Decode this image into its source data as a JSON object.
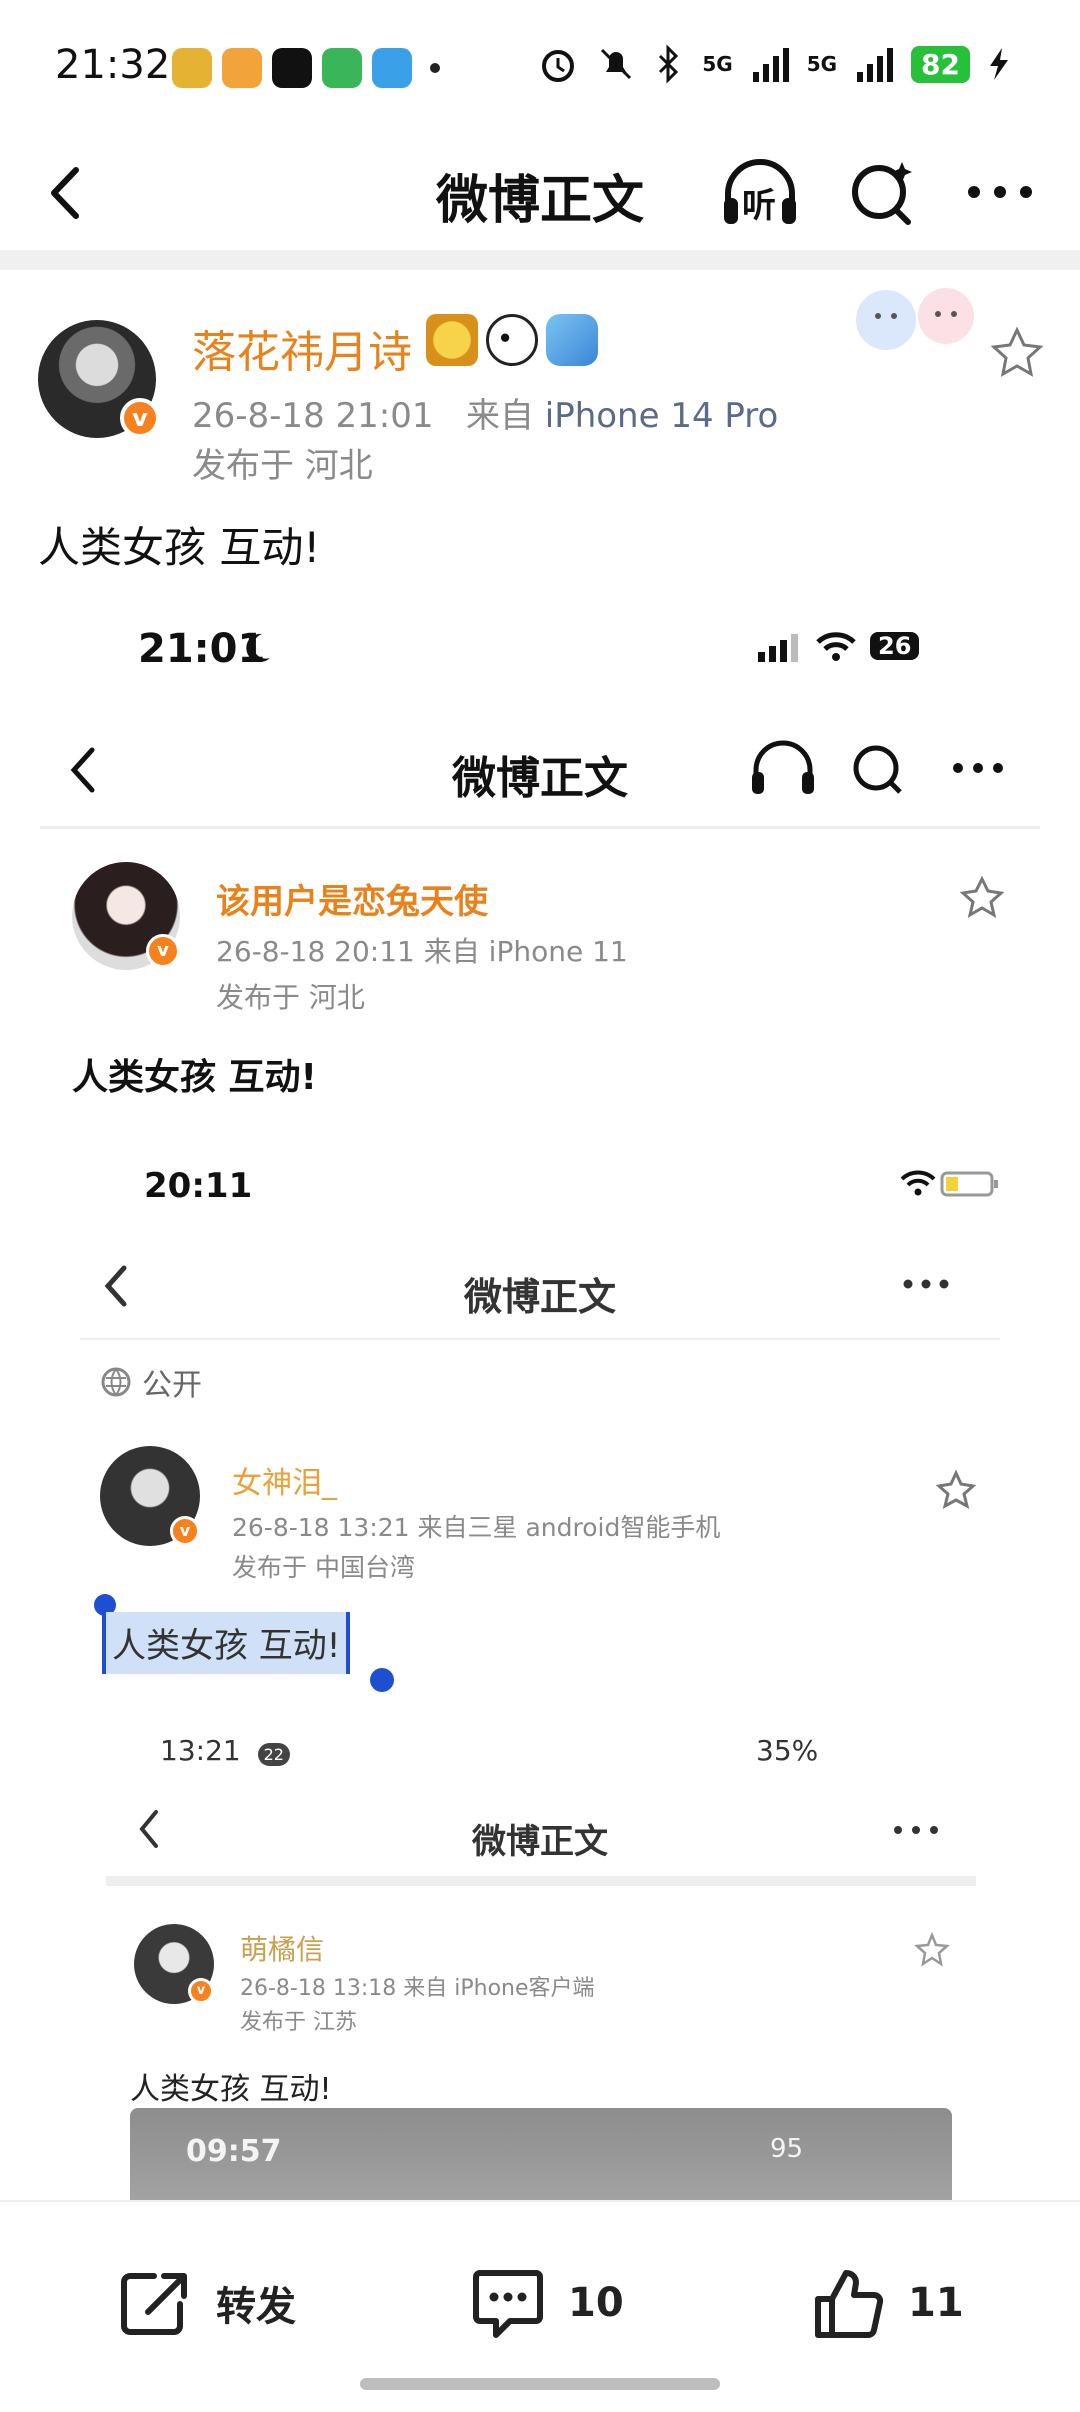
{
  "status_bar": {
    "time": "21:32",
    "network_left": "5G",
    "network_right": "5G",
    "battery": "82"
  },
  "nav": {
    "title": "微博正文",
    "listen_label": "听"
  },
  "post": {
    "author": "落花祎月诗",
    "verified_badge": "v",
    "time": "26-8-18 21:01",
    "source_prefix": "来自",
    "device": "iPhone 14 Pro",
    "location": "发布于 河北",
    "text": "人类女孩 互动!"
  },
  "embed": {
    "level1": {
      "time": "21:01",
      "battery": "26",
      "nav_title": "微博正文",
      "author": "该用户是恋兔天使",
      "meta": "26-8-18 20:11  来自 iPhone 11",
      "location": "发布于 河北",
      "text": "人类女孩 互动!"
    },
    "level2": {
      "time": "20:11",
      "nav_title": "微博正文",
      "visibility": "公开",
      "author": "女神泪_",
      "meta": "26-8-18 13:21  来自三星 android智能手机",
      "location": "发布于 中国台湾",
      "text": "人类女孩 互动!"
    },
    "level3": {
      "time": "13:21",
      "notif_count": "22",
      "battery_text": "35%",
      "nav_title": "微博正文",
      "author": "萌橘信",
      "meta": "26-8-18 13:18  来自 iPhone客户端",
      "location": "发布于 江苏",
      "text": "人类女孩 互动!"
    },
    "level4": {
      "time": "09:57",
      "battery": "95"
    }
  },
  "actions": {
    "repost_label": "转发",
    "comment_count": "10",
    "like_count": "11"
  }
}
